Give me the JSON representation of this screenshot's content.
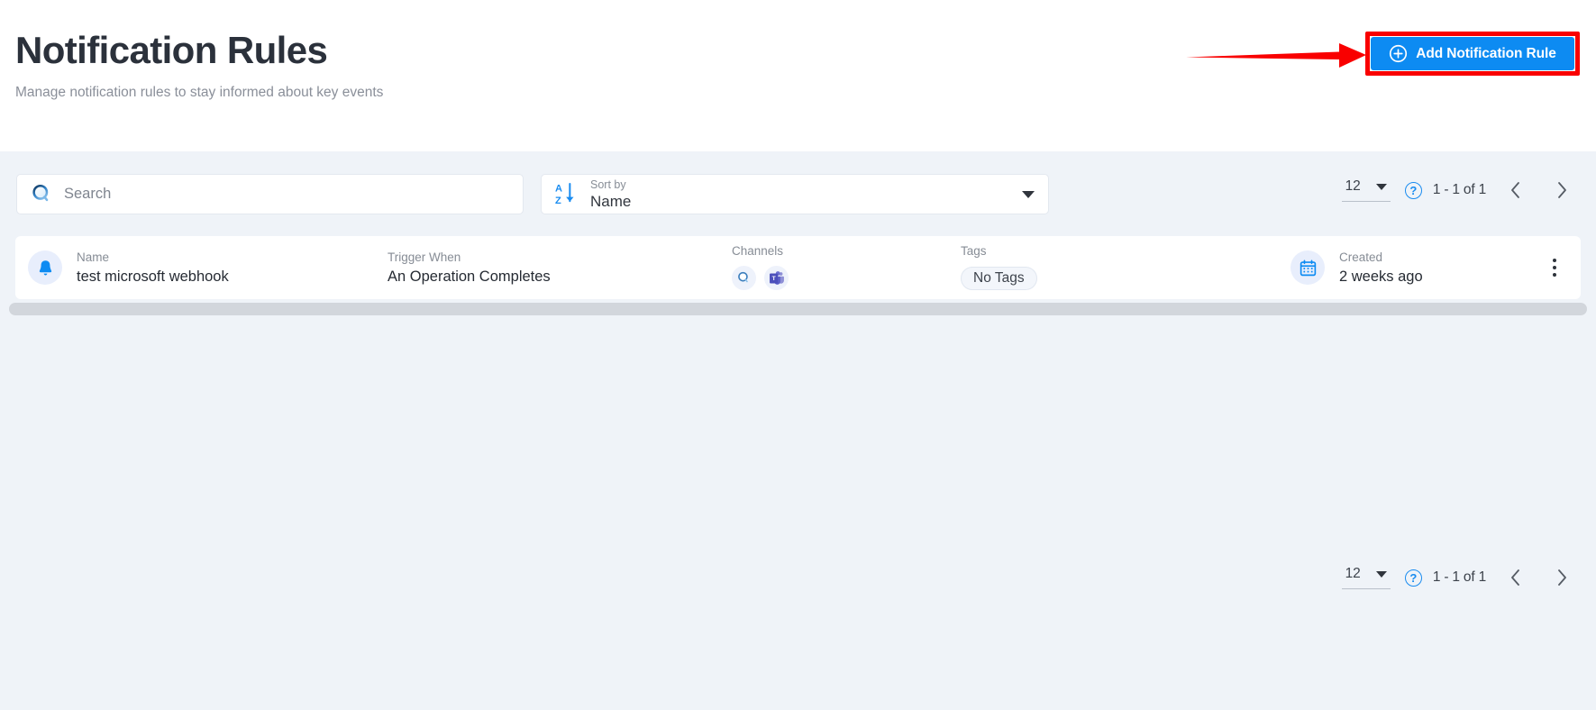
{
  "header": {
    "title": "Notification Rules",
    "subtitle": "Manage notification rules to stay informed about key events",
    "add_button_label": "Add Notification Rule",
    "add_button_icon": "plus-circle-icon",
    "accent_color": "#0d8bf2",
    "annotation_color": "#f90000"
  },
  "toolbar": {
    "search": {
      "placeholder": "Search",
      "value": "",
      "icon": "search-icon"
    },
    "sort": {
      "label": "Sort by",
      "value": "Name",
      "icon": "sort-alpha-down-icon",
      "caret": "chevron-down-icon"
    }
  },
  "pagination": {
    "page_size": "12",
    "page_size_caret": "chevron-down-icon",
    "help_icon": "question-mark-icon",
    "help_glyph": "?",
    "range": "1 - 1 of 1",
    "prev_icon": "chevron-left-icon",
    "next_icon": "chevron-right-icon"
  },
  "table": {
    "columns": [
      "Name",
      "Trigger When",
      "Channels",
      "Tags",
      "Created"
    ],
    "rows": [
      {
        "icon": "bell-icon",
        "name_label": "Name",
        "name_value": "test microsoft webhook",
        "trigger_label": "Trigger When",
        "trigger_value": "An Operation Completes",
        "channels_label": "Channels",
        "channels": [
          "webhook-icon",
          "microsoft-teams-icon"
        ],
        "tags_label": "Tags",
        "tags_value": "No Tags",
        "created_label": "Created",
        "created_value": "2 weeks ago",
        "menu_icon": "kebab-menu-icon"
      }
    ]
  },
  "colors": {
    "page_background": "#eff3f8",
    "header_background": "#ffffff",
    "card_background": "#ffffff",
    "icon_circle": "#e8eefc",
    "scrollbar": "#d2d6dc",
    "teams_purple": "#5b5fc7"
  }
}
